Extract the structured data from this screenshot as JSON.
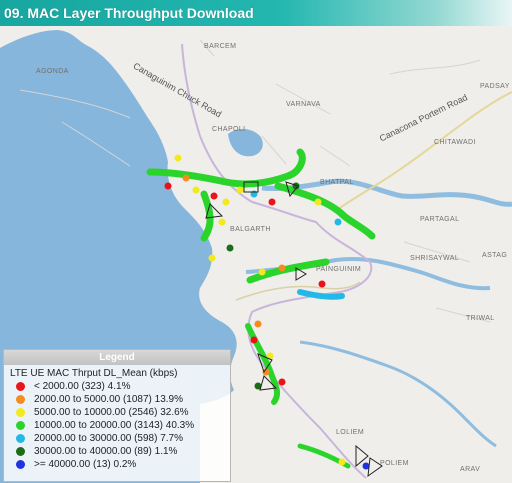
{
  "title": "09. MAC Layer Throughput Download",
  "map": {
    "places": [
      {
        "name": "AGONDA"
      },
      {
        "name": "BARCEM"
      },
      {
        "name": "PADSAY"
      },
      {
        "name": "VARNAVA"
      },
      {
        "name": "CHAPOLI"
      },
      {
        "name": "CHITAWADI"
      },
      {
        "name": "BHATPAL"
      },
      {
        "name": "PARTAGAL"
      },
      {
        "name": "SHRISAYWAL"
      },
      {
        "name": "ASTAG"
      },
      {
        "name": "BALGARTH"
      },
      {
        "name": "PAINGUINIM"
      },
      {
        "name": "TRIWAL"
      },
      {
        "name": "LOLIEM"
      },
      {
        "name": "POLIEM"
      },
      {
        "name": "ARAV"
      }
    ],
    "roads": [
      {
        "name": "Canaguinim Chuck Road"
      },
      {
        "name": "Canacona Portem Road"
      }
    ]
  },
  "legend": {
    "header": "Legend",
    "title": "LTE UE MAC Thrput DL_Mean (kbps)",
    "items": [
      {
        "label": "< 2000.00 (323) 4.1%",
        "color": "#e8141a"
      },
      {
        "label": "2000.00 to 5000.00 (1087) 13.9%",
        "color": "#f58c1e"
      },
      {
        "label": "5000.00 to 10000.00 (2546) 32.6%",
        "color": "#f2ea1d"
      },
      {
        "label": "10000.00 to 20000.00 (3143) 40.3%",
        "color": "#2bd42b"
      },
      {
        "label": "20000.00 to 30000.00 (598) 7.7%",
        "color": "#23b9e6"
      },
      {
        "label": "30000.00 to 40000.00 (89) 1.1%",
        "color": "#1c6b16"
      },
      {
        "label": ">= 40000.00 (13) 0.2%",
        "color": "#1f33e0"
      }
    ]
  }
}
